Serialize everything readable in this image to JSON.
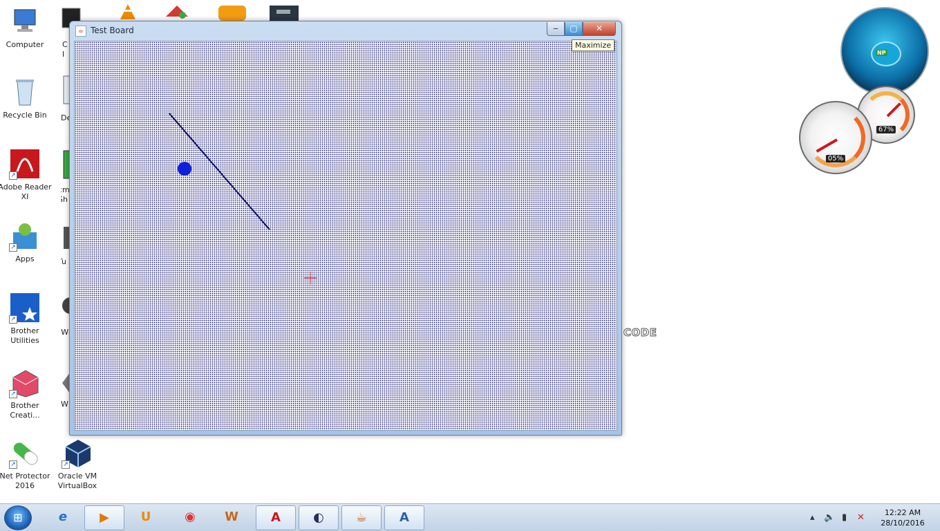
{
  "desktop": {
    "icons": [
      {
        "label": "Computer",
        "icon": "computer-icon"
      },
      {
        "label": "Recycle Bin",
        "icon": "recycle-bin-icon"
      },
      {
        "label": "Adobe Reader XI",
        "icon": "adobe-reader-icon"
      },
      {
        "label": "Apps",
        "icon": "apps-icon"
      },
      {
        "label": "Brother Utilities",
        "icon": "brother-utilities-icon"
      },
      {
        "label": "Brother Creati...",
        "icon": "brother-creative-icon"
      },
      {
        "label": "Net Protector 2016",
        "icon": "net-protector-icon"
      },
      {
        "label": "Oracle VM VirtualBox",
        "icon": "virtualbox-icon"
      }
    ],
    "partial_labels": [
      "C",
      "I",
      "De",
      "cm Sh",
      "Tu",
      "T Win",
      "W"
    ],
    "code_label": "CODE"
  },
  "window": {
    "title": "Test Board",
    "controls": {
      "minimize": "‒",
      "maximize": "▢",
      "close": "✕"
    },
    "tooltip": "Maximize"
  },
  "gadgets": {
    "np_badge": "NP",
    "gauge_cpu": "05%",
    "gauge_mem": "67%"
  },
  "taskbar": {
    "start_glyph": "⊞",
    "apps": [
      {
        "name": "internet-explorer",
        "glyph": "e"
      },
      {
        "name": "media-player",
        "glyph": "▶"
      },
      {
        "name": "uc-browser",
        "glyph": "U"
      },
      {
        "name": "chrome",
        "glyph": "◉"
      },
      {
        "name": "word",
        "glyph": "W"
      },
      {
        "name": "adobe-reader",
        "glyph": "A"
      },
      {
        "name": "eclipse",
        "glyph": "◐"
      },
      {
        "name": "java",
        "glyph": "☕"
      },
      {
        "name": "notepad",
        "glyph": "A"
      }
    ],
    "time": "12:22 AM",
    "date": "28/10/2016"
  },
  "colors": {
    "line": "#0c0c6b",
    "ball": "#1020d8",
    "crosshair": "#e03030"
  }
}
